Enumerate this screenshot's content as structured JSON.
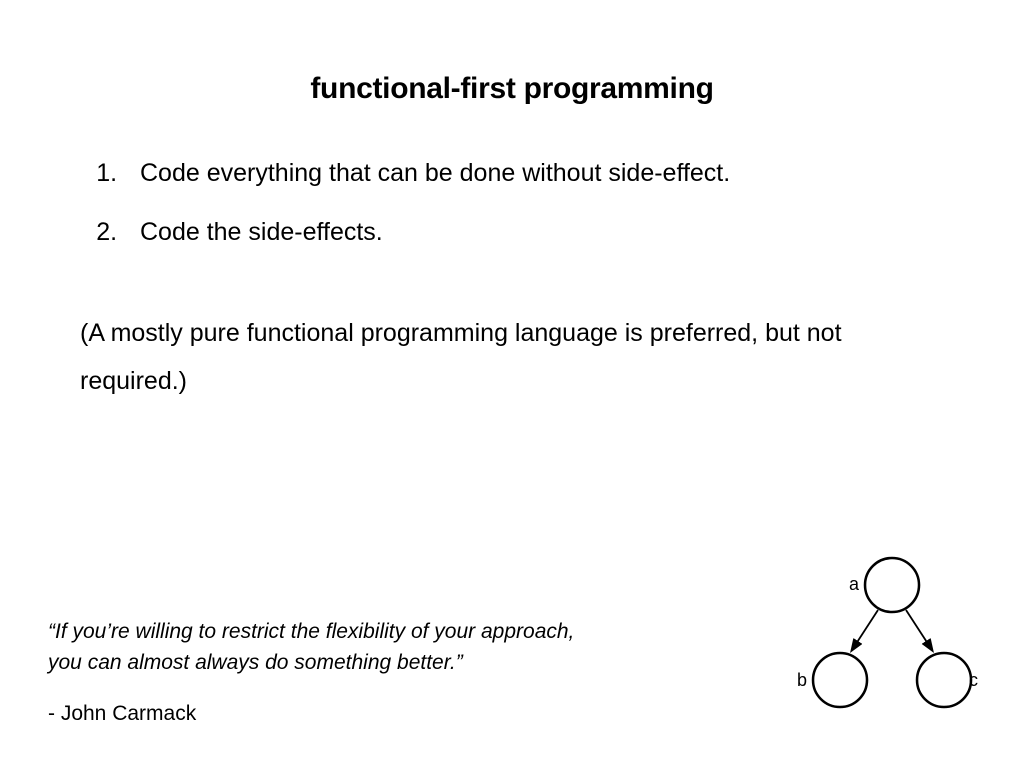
{
  "title": "functional-first programming",
  "points": [
    "Code everything that can be done without side-effect.",
    "Code the side-effects."
  ],
  "note": "(A mostly pure functional programming language is preferred, but not required.)",
  "quote": "“If you’re willing to restrict the flexibility of your approach, you can almost always do something better.”",
  "attribution": "- John Carmack",
  "diagram": {
    "nodes": [
      {
        "id": "a",
        "label": "a"
      },
      {
        "id": "b",
        "label": "b"
      },
      {
        "id": "c",
        "label": "c"
      }
    ]
  }
}
